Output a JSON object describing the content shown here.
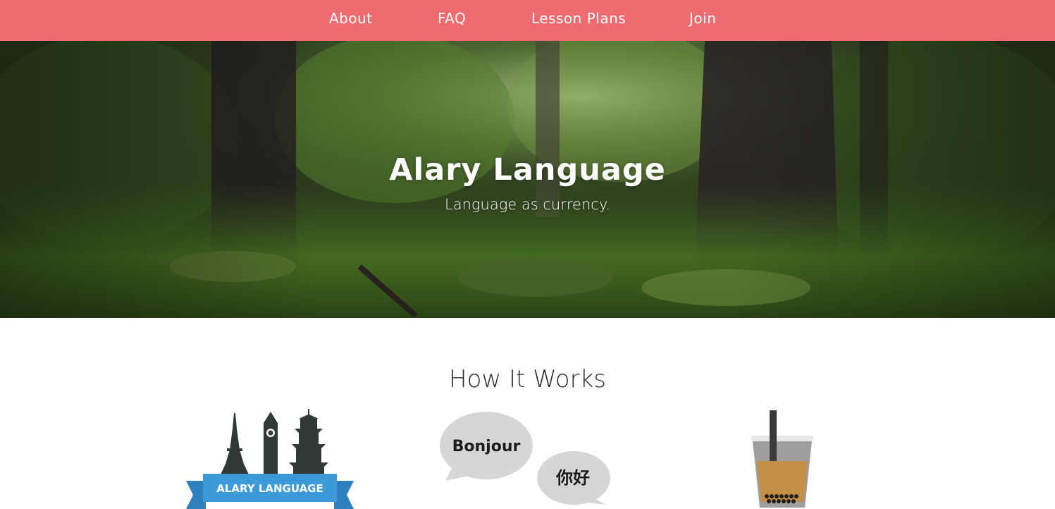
{
  "nav": {
    "items": [
      {
        "label": "About"
      },
      {
        "label": "FAQ"
      },
      {
        "label": "Lesson Plans"
      },
      {
        "label": "Join"
      }
    ],
    "background_color": "#ef6b6f"
  },
  "hero": {
    "title": "Alary Language",
    "subtitle": "Language as currency."
  },
  "how_it_works": {
    "title": "How It Works",
    "steps": [
      {
        "icon": "landmarks-logo-icon",
        "banner_text": "ALARY LANGUAGE",
        "accent_color": "#3d9ad9"
      },
      {
        "icon": "speech-bubbles-icon",
        "bubble_1": "Bonjour",
        "bubble_2": "你好"
      },
      {
        "icon": "bubble-tea-icon"
      }
    ]
  }
}
